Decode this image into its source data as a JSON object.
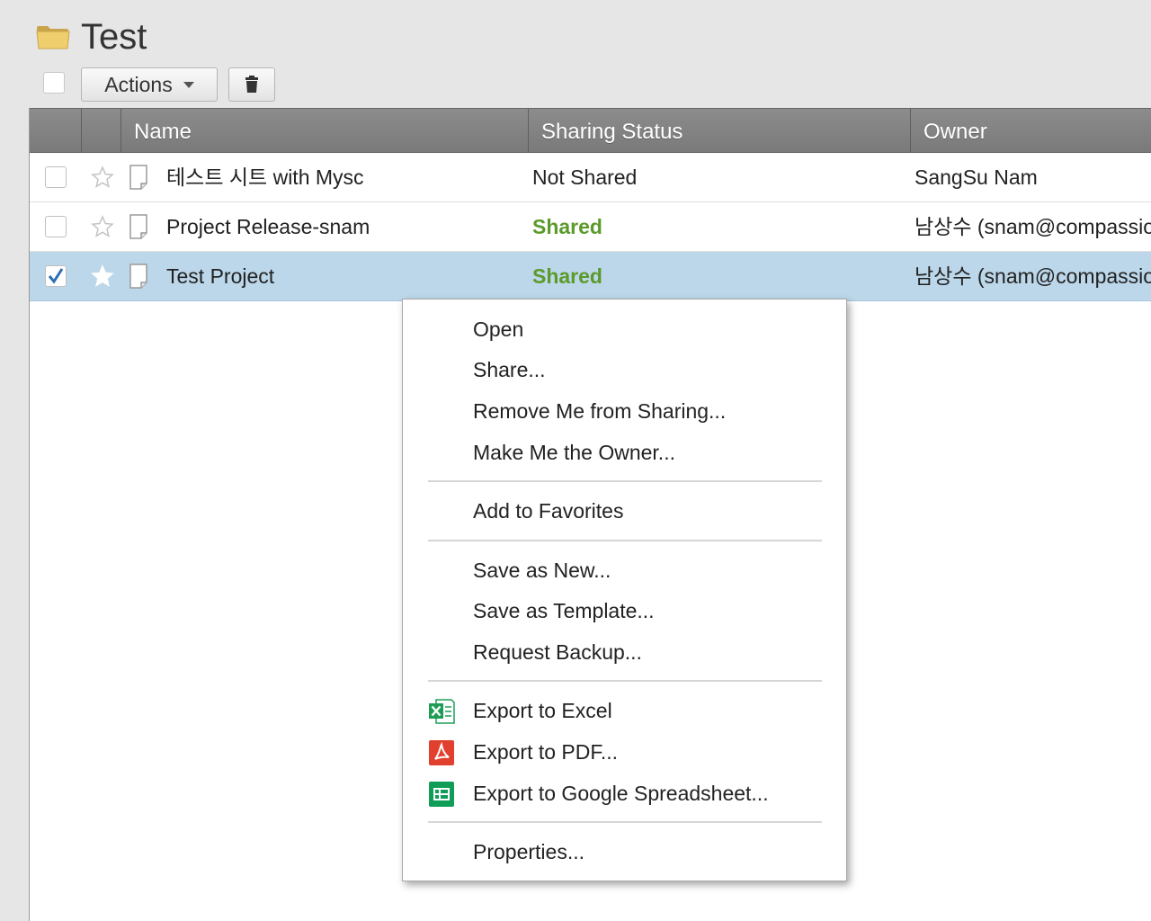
{
  "header": {
    "title": "Test",
    "folder_icon": "folder-icon"
  },
  "toolbar": {
    "actions_label": "Actions",
    "trash_icon": "trash-icon"
  },
  "table": {
    "columns": [
      "Name",
      "Sharing Status",
      "Owner"
    ],
    "rows": [
      {
        "name": "테스트 시트 with Mysc",
        "status": "Not Shared",
        "owner": "SangSu Nam",
        "checked": false,
        "selected": false
      },
      {
        "name": "Project Release-snam",
        "status": "Shared",
        "owner": "남상수 (snam@compassio",
        "checked": false,
        "selected": false
      },
      {
        "name": "Test Project",
        "status": "Shared",
        "owner": "남상수 (snam@compassio",
        "checked": true,
        "selected": true
      }
    ]
  },
  "context_menu": {
    "items": [
      {
        "label": "Open"
      },
      {
        "label": "Share..."
      },
      {
        "label": "Remove Me from Sharing..."
      },
      {
        "label": "Make Me the Owner..."
      },
      {
        "label": "Add to Favorites"
      },
      {
        "label": "Save as New..."
      },
      {
        "label": "Save as Template..."
      },
      {
        "label": "Request Backup..."
      },
      {
        "label": "Export to Excel",
        "icon": "excel-icon"
      },
      {
        "label": "Export to PDF...",
        "icon": "pdf-icon"
      },
      {
        "label": "Export to Google Spreadsheet...",
        "icon": "google-sheets-icon"
      },
      {
        "label": "Properties..."
      }
    ]
  },
  "colors": {
    "header_bg": "#858585",
    "selected_row": "#bcd7ea",
    "shared_text": "#5c9a2b",
    "excel_green": "#1f9d55",
    "pdf_red": "#e2402f",
    "sheets_green": "#0f9d58"
  }
}
